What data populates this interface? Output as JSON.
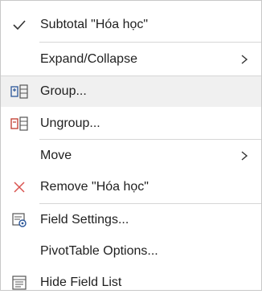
{
  "menu": {
    "items": [
      {
        "id": "subtotal",
        "label": "Subtotal \"Hóa học\"",
        "icon": "checkmark-icon",
        "checked": true
      },
      {
        "id": "expand",
        "label": "Expand/Collapse",
        "icon": "",
        "submenu": true
      },
      {
        "id": "group",
        "label": "Group...",
        "icon": "group-icon"
      },
      {
        "id": "ungroup",
        "label": "Ungroup...",
        "icon": "ungroup-icon"
      },
      {
        "id": "move",
        "label": "Move",
        "icon": "",
        "submenu": true
      },
      {
        "id": "remove",
        "label": "Remove \"Hóa học\"",
        "icon": "remove-icon"
      },
      {
        "id": "field-settings",
        "label": "Field Settings...",
        "icon": "field-settings-icon"
      },
      {
        "id": "pivot-options",
        "label": "PivotTable Options...",
        "icon": ""
      },
      {
        "id": "hide-field-list",
        "label": "Hide Field List",
        "icon": "field-list-icon"
      }
    ]
  },
  "colors": {
    "accent": "#2b579a",
    "remove": "#d9534f",
    "hover": "#f0f0f0",
    "separator": "#d6d6d6"
  }
}
